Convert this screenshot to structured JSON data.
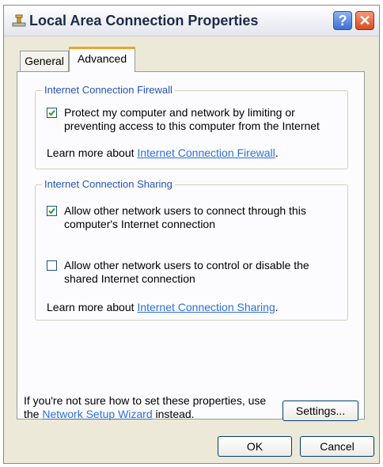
{
  "window": {
    "title": "Local Area Connection Properties",
    "help_label": "?",
    "close_label": "✕"
  },
  "tabs": [
    {
      "label": "General",
      "selected": false
    },
    {
      "label": "Advanced",
      "selected": true
    }
  ],
  "firewall": {
    "legend": "Internet Connection Firewall",
    "option_text": "Protect my computer and network by limiting or preventing access to this computer from the Internet",
    "checked": true,
    "learn_prefix": "Learn more about ",
    "learn_link": "Internet Connection Firewall",
    "learn_suffix": "."
  },
  "sharing": {
    "legend": "Internet Connection Sharing",
    "option1_text": "Allow other network users to connect through this computer's Internet connection",
    "option1_checked": true,
    "option2_text": "Allow other network users to control or disable the shared Internet connection",
    "option2_checked": false,
    "learn_prefix": "Learn more about ",
    "learn_link": "Internet Connection Sharing",
    "learn_suffix": "."
  },
  "footer": {
    "text_line1": "If you're not sure how to set these properties, use",
    "text_prefix": "the ",
    "wizard_link": "Network Setup Wizard",
    "text_suffix": " instead.",
    "settings_button": "Settings..."
  },
  "buttons": {
    "ok": "OK",
    "cancel": "Cancel"
  }
}
